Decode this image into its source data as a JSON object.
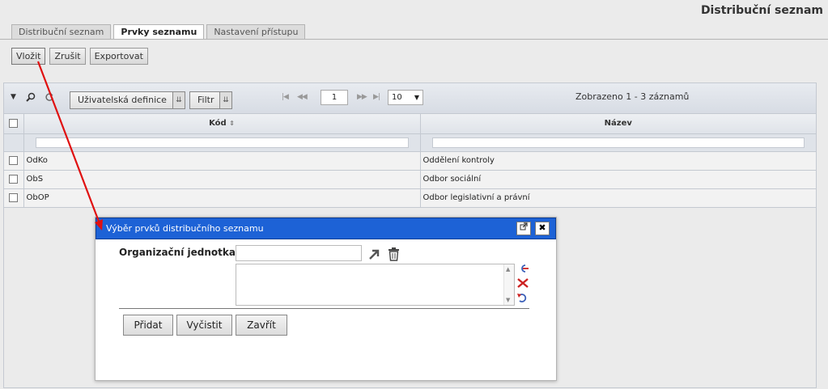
{
  "page": {
    "title": "Distribuční seznam"
  },
  "tabs": [
    {
      "label": "Distribuční seznam",
      "active": false
    },
    {
      "label": "Prvky seznamu",
      "active": true
    },
    {
      "label": "Nastavení přístupu",
      "active": false
    }
  ],
  "toolbar": {
    "insert": "Vložit",
    "cancel": "Zrušit",
    "export": "Exportovat"
  },
  "grid": {
    "toolbar": {
      "user_definition": "Uživatelská definice",
      "filter": "Filtr",
      "page": "1",
      "rows_per_page": "10",
      "record_count": "Zobrazeno 1 - 3 záznamů"
    },
    "columns": {
      "code": "Kód",
      "name": "Název"
    },
    "rows": [
      {
        "code": "OdKo",
        "name": "Oddělení kontroly"
      },
      {
        "code": "ObS",
        "name": "Odbor sociální"
      },
      {
        "code": "ObOP",
        "name": "Odbor legislativní a právní"
      }
    ]
  },
  "dialog": {
    "title": "Výběr prvků distribučního seznamu",
    "org_label": "Organizační jednotka:",
    "org_value": "",
    "buttons": {
      "add": "Přidat",
      "clear": "Vyčistit",
      "close": "Zavřít"
    }
  },
  "colors": {
    "dialog_title_bg": "#1d62d6",
    "annotation_arrow": "#e01010"
  }
}
